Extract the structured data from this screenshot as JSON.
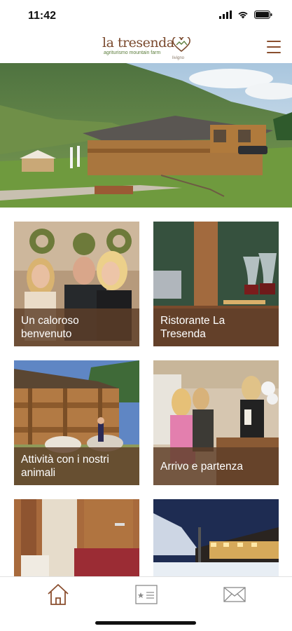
{
  "status": {
    "time": "11:42"
  },
  "brand": {
    "name": "la tresenda",
    "tagline": "agriturismo mountain farm",
    "place": "livigno"
  },
  "tiles": [
    {
      "label": "Un caloroso benvenuto"
    },
    {
      "label": "Ristorante La Tresenda"
    },
    {
      "label": "Attività con i nostri animali"
    },
    {
      "label": "Arrivo e partenza"
    },
    {
      "label": ""
    },
    {
      "label": ""
    }
  ],
  "tabs": [
    {
      "icon": "home-icon"
    },
    {
      "icon": "review-card-icon"
    },
    {
      "icon": "mail-icon"
    }
  ],
  "colors": {
    "accent": "#8a4e2e",
    "caption_bg": "#5e3e28",
    "logo_green": "#5b7c3a"
  }
}
